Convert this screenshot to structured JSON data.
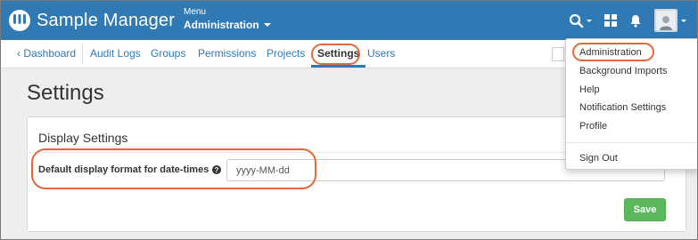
{
  "header": {
    "app_name": "Sample Manager",
    "menu_small": "Menu",
    "menu_current": "Administration"
  },
  "nav": {
    "dashboard": "Dashboard",
    "items": [
      "Audit Logs",
      "Groups",
      "Permissions",
      "Projects",
      "Settings",
      "Users"
    ],
    "active": "Settings"
  },
  "page": {
    "title": "Settings",
    "panel_heading": "Display Settings",
    "field_label": "Default display format for date-times",
    "field_value": "yyyy-MM-dd",
    "save_label": "Save"
  },
  "user_menu": {
    "items": [
      "Administration",
      "Background Imports",
      "Help",
      "Notification Settings",
      "Profile"
    ],
    "sign_out": "Sign Out"
  },
  "colors": {
    "header_bg": "#2f79b5",
    "link": "#2f79b5",
    "save_green": "#5cb85c",
    "highlight_ring": "#e2683c"
  },
  "icons": [
    "logo-icon",
    "search-icon",
    "grid-icon",
    "bell-icon",
    "user-avatar-icon",
    "chevron-left-icon",
    "help-circle-icon",
    "caret-down-icon"
  ]
}
